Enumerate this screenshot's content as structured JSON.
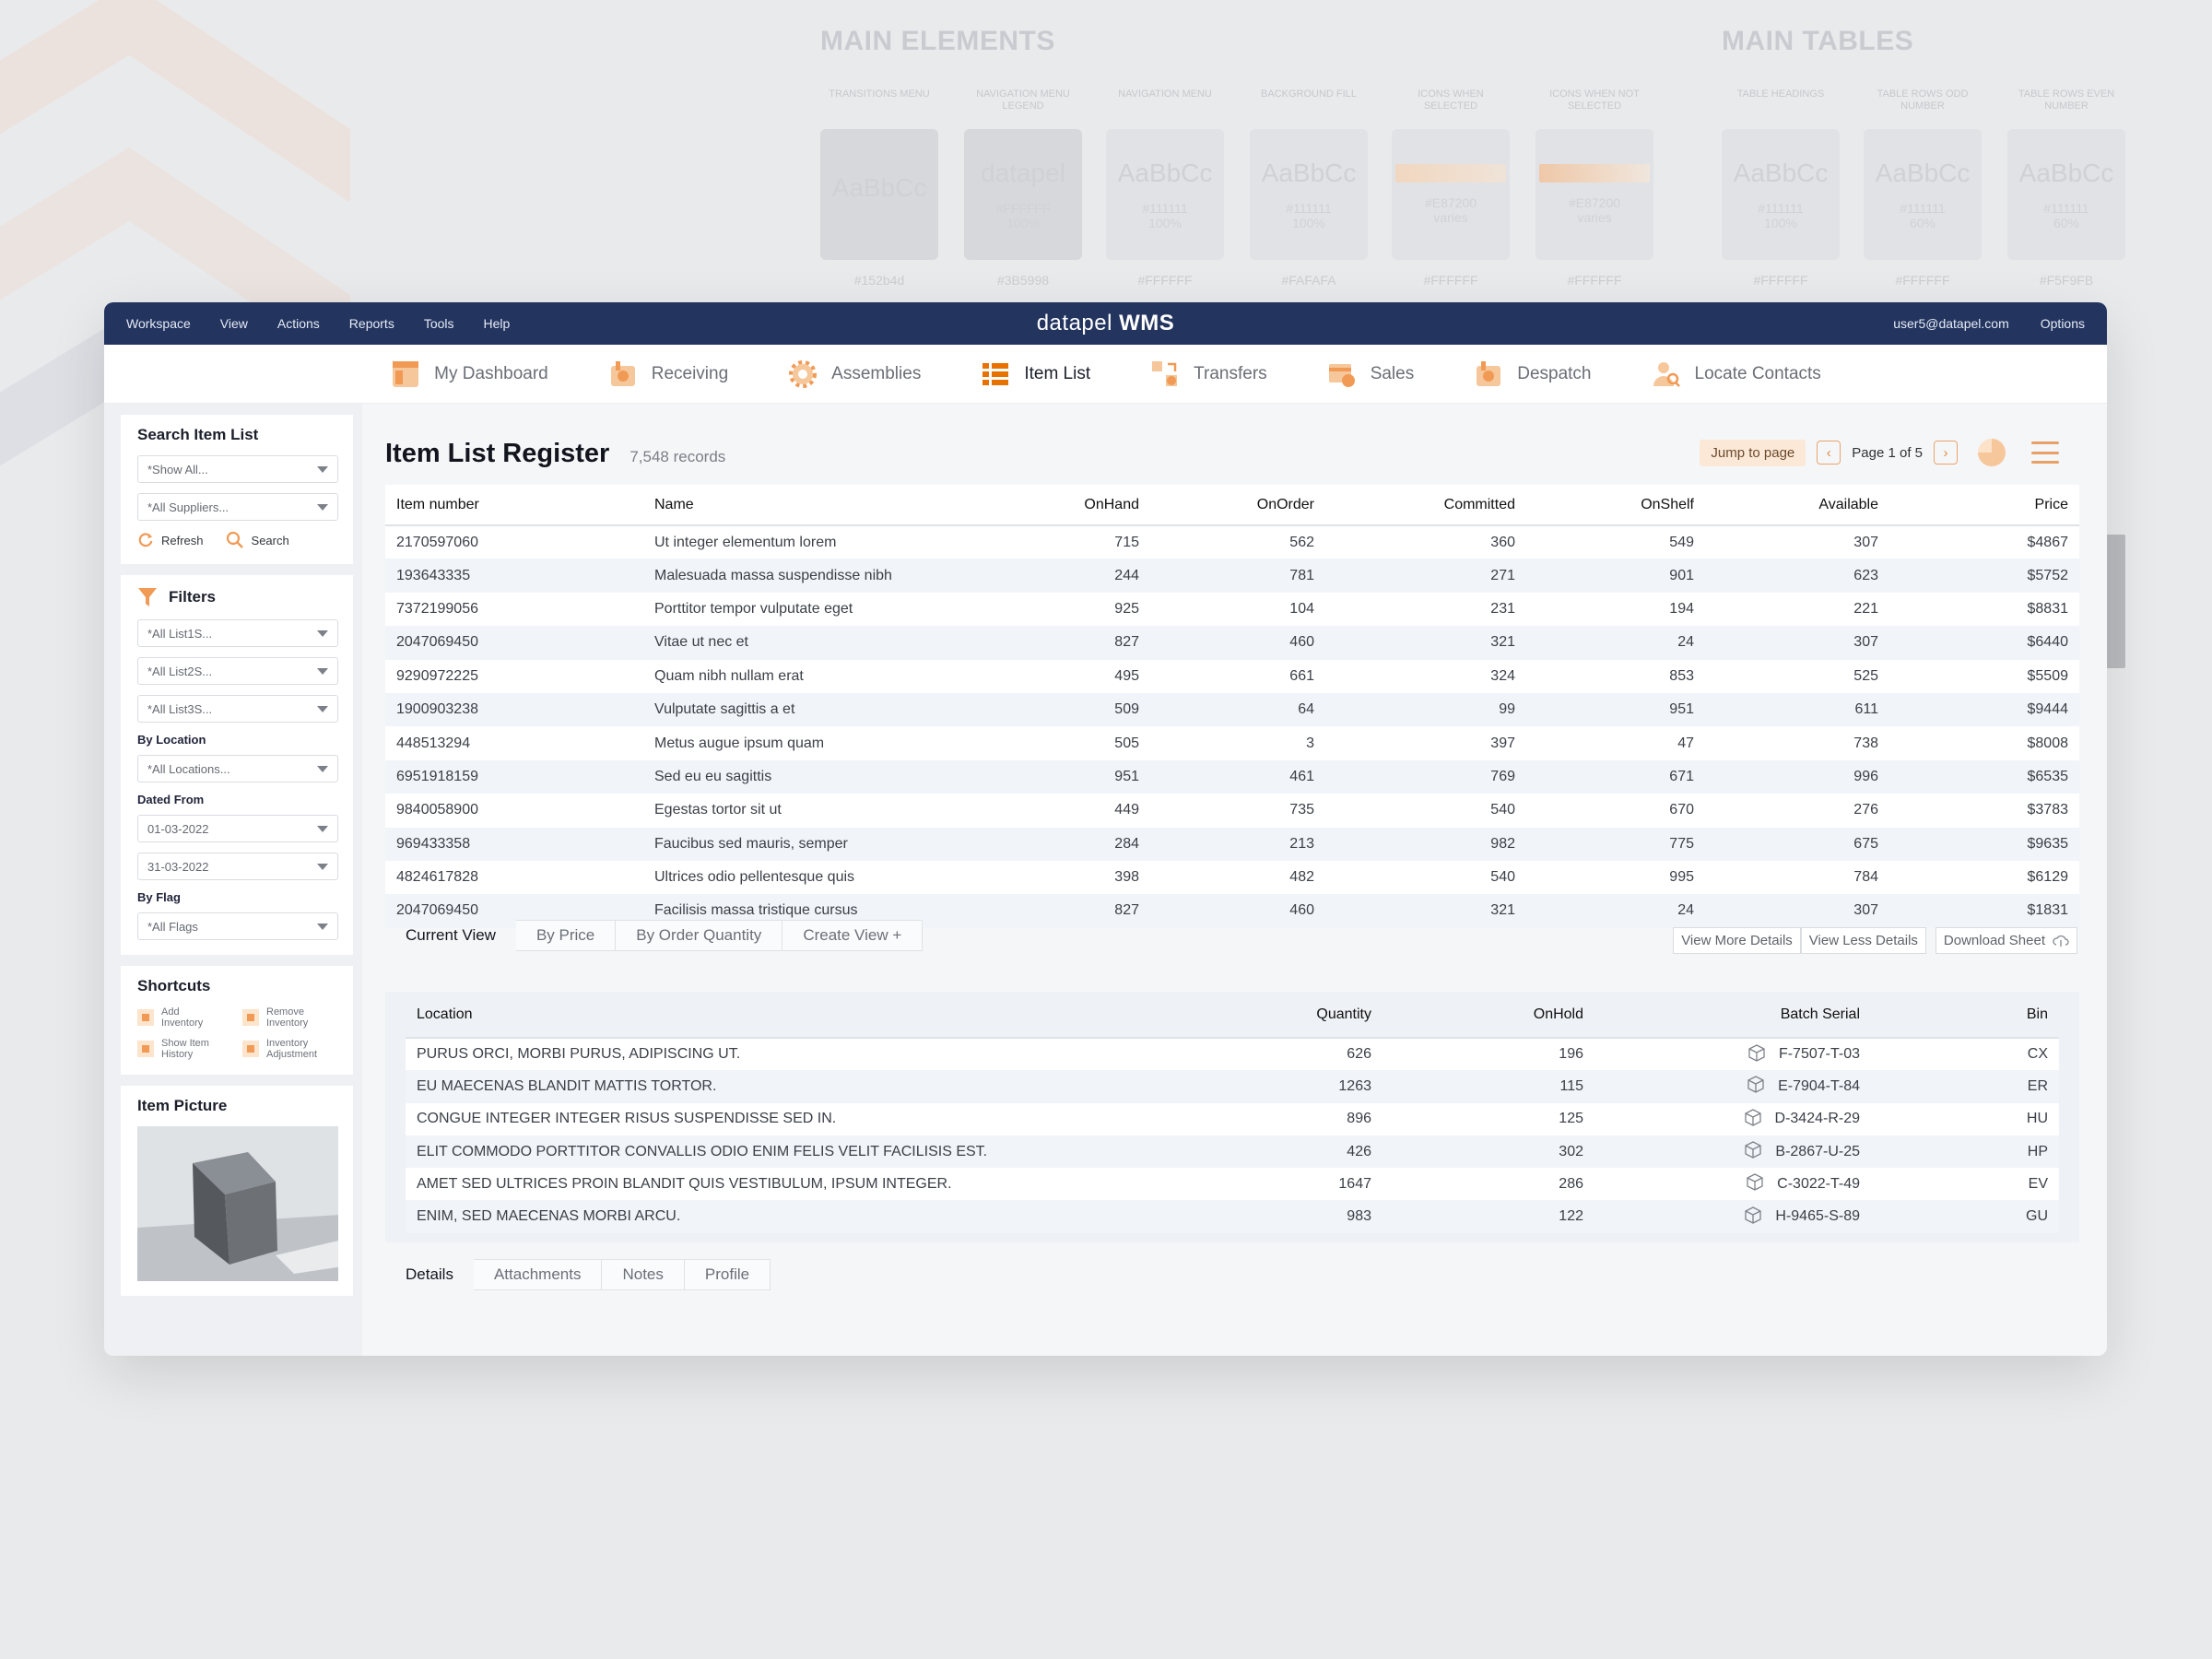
{
  "background": {
    "title_left": "MAIN ELEMENTS",
    "title_right": "MAIN TABLES",
    "columns": [
      {
        "cap": "TRANSITIONS MENU",
        "aa": "AaBbCc",
        "hex": "",
        "sub": "",
        "foot": "#152b4d",
        "style": "dark"
      },
      {
        "cap": "NAVIGATION MENU LEGEND",
        "aa": "datapel",
        "hex": "#FFFFFF",
        "sub": "100%",
        "foot": "#3B5998",
        "style": "dark"
      },
      {
        "cap": "NAVIGATION MENU",
        "aa": "AaBbCc",
        "hex": "#111111",
        "sub": "100%",
        "foot": "#FFFFFF",
        "style": "light"
      },
      {
        "cap": "BACKGROUND FILL",
        "aa": "AaBbCc",
        "hex": "#111111",
        "sub": "100%",
        "foot": "#FAFAFA",
        "style": "light"
      },
      {
        "cap": "ICONS WHEN SELECTED",
        "aa": "",
        "hex": "#E87200",
        "sub": "varies",
        "foot": "#FFFFFF",
        "style": "grad"
      },
      {
        "cap": "ICONS WHEN NOT SELECTED",
        "aa": "",
        "hex": "#E87200",
        "sub": "varies",
        "foot": "#FFFFFF",
        "style": "grad2"
      },
      {
        "cap": "TABLE HEADINGS",
        "aa": "AaBbCc",
        "hex": "#111111",
        "sub": "100%",
        "foot": "#FFFFFF",
        "style": "light"
      },
      {
        "cap": "TABLE ROWS ODD NUMBER",
        "aa": "AaBbCc",
        "hex": "#111111",
        "sub": "60%",
        "foot": "#FFFFFF",
        "style": "light"
      },
      {
        "cap": "TABLE ROWS EVEN NUMBER",
        "aa": "AaBbCc",
        "hex": "#111111",
        "sub": "60%",
        "foot": "#F5F9FB",
        "style": "light"
      }
    ]
  },
  "topbar": {
    "menu": [
      "Workspace",
      "View",
      "Actions",
      "Reports",
      "Tools",
      "Help"
    ],
    "brand_light": "datapel",
    "brand_bold": "WMS",
    "user": "user5@datapel.com",
    "options": "Options"
  },
  "nav": [
    {
      "label": "My Dashboard",
      "icon": "dashboard-icon",
      "active": false
    },
    {
      "label": "Receiving",
      "icon": "receiving-icon",
      "active": false
    },
    {
      "label": "Assemblies",
      "icon": "gear-icon",
      "active": false
    },
    {
      "label": "Item List",
      "icon": "list-icon",
      "active": true
    },
    {
      "label": "Transfers",
      "icon": "transfer-icon",
      "active": false
    },
    {
      "label": "Sales",
      "icon": "sales-icon",
      "active": false
    },
    {
      "label": "Despatch",
      "icon": "despatch-icon",
      "active": false
    },
    {
      "label": "Locate Contacts",
      "icon": "contact-icon",
      "active": false
    }
  ],
  "sidebar": {
    "search": {
      "title": "Search Item List",
      "show_all": "*Show All...",
      "suppliers": "*All Suppliers...",
      "refresh": "Refresh",
      "search": "Search"
    },
    "filters": {
      "title": "Filters",
      "list1": "*All List1S...",
      "list2": "*All List2S...",
      "list3": "*All List3S...",
      "by_location_label": "By Location",
      "location": "*All Locations...",
      "dated_from_label": "Dated From",
      "date_from": "01-03-2022",
      "date_to": "31-03-2022",
      "by_flag_label": "By Flag",
      "flag": "*All Flags"
    },
    "shortcuts": {
      "title": "Shortcuts",
      "items": [
        {
          "line1": "Add",
          "line2": "Inventory"
        },
        {
          "line1": "Remove",
          "line2": "Inventory"
        },
        {
          "line1": "Show Item",
          "line2": "History"
        },
        {
          "line1": "Inventory",
          "line2": "Adjustment"
        }
      ]
    },
    "picture": {
      "title": "Item Picture"
    }
  },
  "main": {
    "title": "Item List Register",
    "records": "7,548 records",
    "jump": "Jump to page",
    "page_text": "Page 1 of 5",
    "columns": [
      "Item number",
      "Name",
      "OnHand",
      "OnOrder",
      "Committed",
      "OnShelf",
      "Available",
      "Price"
    ],
    "rows": [
      [
        "2170597060",
        "Ut integer elementum lorem",
        "715",
        "562",
        "360",
        "549",
        "307",
        "$4867"
      ],
      [
        "193643335",
        "Malesuada massa suspendisse nibh",
        "244",
        "781",
        "271",
        "901",
        "623",
        "$5752"
      ],
      [
        "7372199056",
        "Porttitor tempor vulputate eget",
        "925",
        "104",
        "231",
        "194",
        "221",
        "$8831"
      ],
      [
        "2047069450",
        "Vitae ut nec et",
        "827",
        "460",
        "321",
        "24",
        "307",
        "$6440"
      ],
      [
        "9290972225",
        "Quam nibh nullam erat",
        "495",
        "661",
        "324",
        "853",
        "525",
        "$5509"
      ],
      [
        "1900903238",
        "Vulputate sagittis a et",
        "509",
        "64",
        "99",
        "951",
        "611",
        "$9444"
      ],
      [
        "448513294",
        "Metus augue ipsum quam",
        "505",
        "3",
        "397",
        "47",
        "738",
        "$8008"
      ],
      [
        "6951918159",
        "Sed eu eu sagittis",
        "951",
        "461",
        "769",
        "671",
        "996",
        "$6535"
      ],
      [
        "9840058900",
        "Egestas tortor sit ut",
        "449",
        "735",
        "540",
        "670",
        "276",
        "$3783"
      ],
      [
        "969433358",
        "Faucibus sed mauris, semper",
        "284",
        "213",
        "982",
        "775",
        "675",
        "$9635"
      ],
      [
        "4824617828",
        "Ultrices odio pellentesque quis",
        "398",
        "482",
        "540",
        "995",
        "784",
        "$6129"
      ],
      [
        "2047069450",
        "Facilisis massa tristique cursus",
        "827",
        "460",
        "321",
        "24",
        "307",
        "$1831"
      ]
    ],
    "view_tabs": [
      "Current View",
      "By Price",
      "By Order Quantity",
      "Create View +"
    ],
    "view_more": "View More Details",
    "view_less": "View Less Details",
    "download": "Download Sheet",
    "detail_columns": [
      "Location",
      "Quantity",
      "OnHold",
      "Batch Serial",
      "Bin"
    ],
    "detail_rows": [
      [
        "PURUS ORCI, MORBI PURUS, ADIPISCING UT.",
        "626",
        "196",
        "F-7507-T-03",
        "CX"
      ],
      [
        "EU MAECENAS BLANDIT MATTIS TORTOR.",
        "1263",
        "115",
        "E-7904-T-84",
        "ER"
      ],
      [
        "CONGUE INTEGER INTEGER RISUS SUSPENDISSE SED IN.",
        "896",
        "125",
        "D-3424-R-29",
        "HU"
      ],
      [
        "ELIT COMMODO PORTTITOR CONVALLIS ODIO ENIM FELIS VELIT FACILISIS EST.",
        "426",
        "302",
        "B-2867-U-25",
        "HP"
      ],
      [
        "AMET SED ULTRICES PROIN BLANDIT QUIS VESTIBULUM, IPSUM INTEGER.",
        "1647",
        "286",
        "C-3022-T-49",
        "EV"
      ],
      [
        "ENIM, SED MAECENAS MORBI ARCU.",
        "983",
        "122",
        "H-9465-S-89",
        "GU"
      ]
    ],
    "detail_tabs": [
      "Details",
      "Attachments",
      "Notes",
      "Profile"
    ]
  },
  "colors": {
    "accent": "#E87200",
    "nav_bg": "#23345F",
    "icon_orange": "#F09A55"
  }
}
